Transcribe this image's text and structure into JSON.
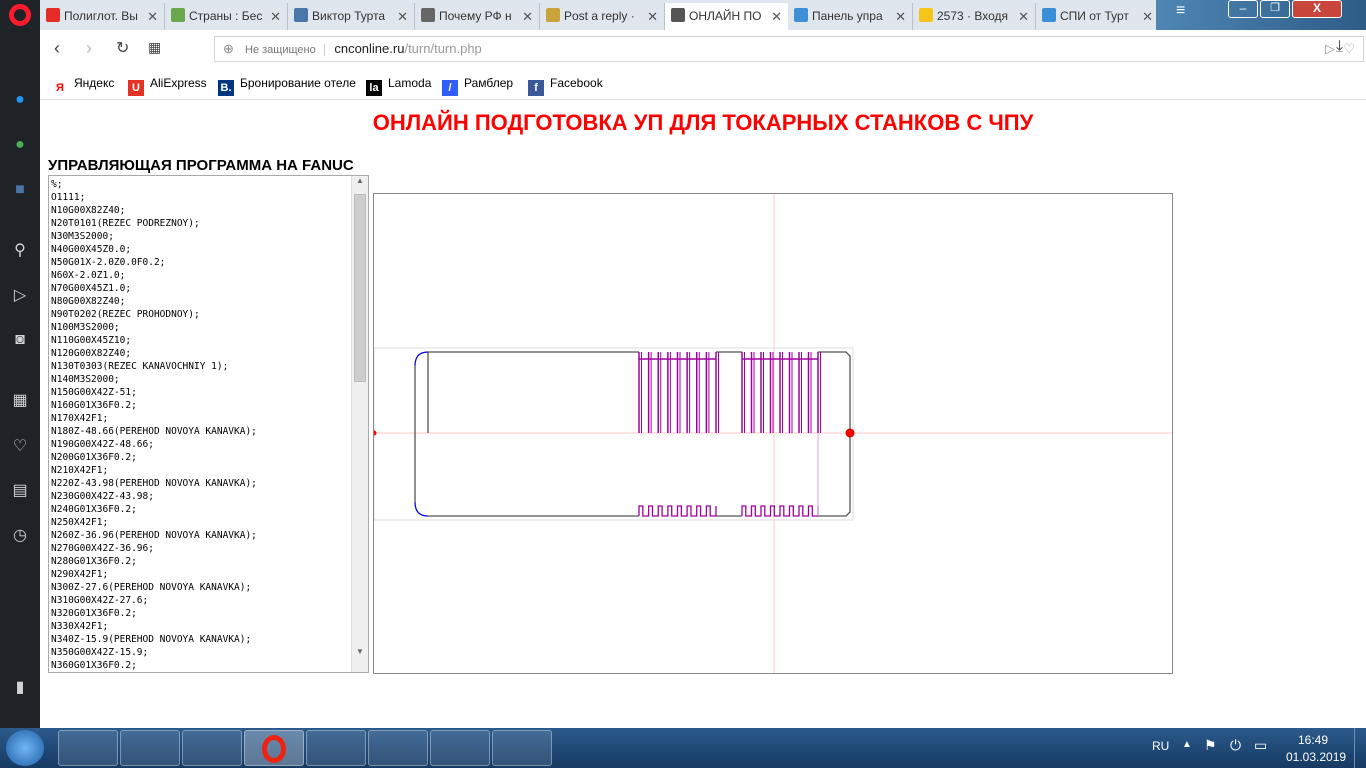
{
  "browser": {
    "tabs": [
      {
        "label": "Полиглот. Вы",
        "color": "#e52d27"
      },
      {
        "label": "Страны : Бес",
        "color": "#6aa84f"
      },
      {
        "label": "Виктор Турта",
        "color": "#4a76a8"
      },
      {
        "label": "Почему РФ н",
        "color": "#666666"
      },
      {
        "label": "Post a reply ·",
        "color": "#c9a43a"
      },
      {
        "label": "ОНЛАЙН ПО",
        "color": "#555555"
      },
      {
        "label": "Панель упра",
        "color": "#3d8fd6"
      },
      {
        "label": "2573 · Входя",
        "color": "#f5c518"
      },
      {
        "label": "СПИ от Турт",
        "color": "#3a8fd6"
      }
    ],
    "security": "Не защищено",
    "url_host": "cnconline.ru",
    "url_path": "/turn/turn.php",
    "bookmarks": [
      {
        "label": "Яндекс",
        "icon": "Я",
        "color": "#ff0000"
      },
      {
        "label": "AliExpress",
        "icon": "U",
        "color": "#e43225"
      },
      {
        "label": "Бронирование отеле",
        "icon": "B.",
        "color": "#003580"
      },
      {
        "label": "Lamoda",
        "icon": "la",
        "color": "#000000"
      },
      {
        "label": "Рамблер",
        "icon": "/",
        "color": "#315efb"
      },
      {
        "label": "Facebook",
        "icon": "f",
        "color": "#3b5998"
      }
    ]
  },
  "page": {
    "title": "ОНЛАЙН ПОДГОТОВКА УП ДЛЯ ТОКАРНЫХ СТАНКОВ С ЧПУ",
    "subtitle": "УПРАВЛЯЮЩАЯ ПРОГРАММА НА FANUC",
    "program": "%;\nO1111;\nN10G00X82Z40;\nN20T0101(REZEC PODREZNOY);\nN30M3S2000;\nN40G00X45Z0.0;\nN50G01X-2.0Z0.0F0.2;\nN60X-2.0Z1.0;\nN70G00X45Z1.0;\nN80G00X82Z40;\nN90T0202(REZEC PROHODNOY);\nN100M3S2000;\nN110G00X45Z10;\nN120G00X82Z40;\nN130T0303(REZEC KANAVOCHNIY 1);\nN140M3S2000;\nN150G00X42Z-51;\nN160G01X36F0.2;\nN170X42F1;\nN180Z-48.66(PEREHOD NOVOYA KANAVKA);\nN190G00X42Z-48.66;\nN200G01X36F0.2;\nN210X42F1;\nN220Z-43.98(PEREHOD NOVOYA KANAVKA);\nN230G00X42Z-43.98;\nN240G01X36F0.2;\nN250X42F1;\nN260Z-36.96(PEREHOD NOVOYA KANAVKA);\nN270G00X42Z-36.96;\nN280G01X36F0.2;\nN290X42F1;\nN300Z-27.6(PEREHOD NOVOYA KANAVKA);\nN310G00X42Z-27.6;\nN320G01X36F0.2;\nN330X42F1;\nN340Z-15.9(PEREHOD NOVOYA KANAVKA);\nN350G00X42Z-15.9;\nN360G01X36F0.2;",
    "colors": {
      "title": "#ff0000",
      "groove": "#a000a0",
      "radius": "#0000ff",
      "axis": "#ffc8c8",
      "outline": "#555555"
    }
  },
  "taskbar": {
    "lang": "RU",
    "time": "16:49",
    "date": "01.03.2019"
  }
}
